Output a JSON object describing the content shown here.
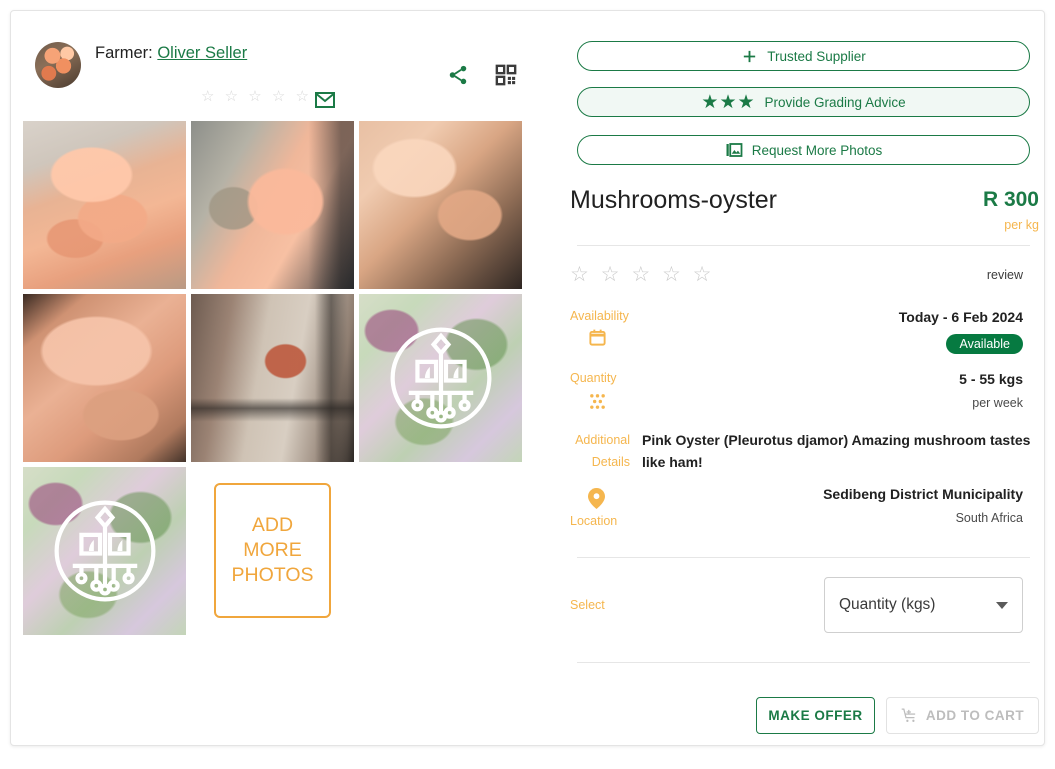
{
  "header": {
    "farmer_prefix": "Farmer:",
    "farmer_name": "Oliver Seller",
    "farmer_stars": "☆ ☆ ☆ ☆ ☆",
    "avatar_name": "farmer-avatar",
    "mail_icon": "mail-icon",
    "share_icon": "share-icon",
    "qr_icon": "qr-code-icon"
  },
  "gallery": {
    "add_more_label": "ADD\nMORE\nPHOTOS",
    "photos": [
      {
        "alt": "pink-oyster-mushroom-held-in-hand"
      },
      {
        "alt": "pink-oyster-mushroom-growing-on-substrate"
      },
      {
        "alt": "pink-oyster-mushroom-cluster-closeup"
      },
      {
        "alt": "pink-oyster-mushroom-caps-macro"
      },
      {
        "alt": "mushroom-fruiting-block-on-shelf"
      },
      {
        "alt": "placeholder-logo-vegetables"
      },
      {
        "alt": "placeholder-logo-vegetables"
      },
      {
        "alt": "placeholder-logo-vegetables"
      }
    ]
  },
  "actions": {
    "trusted_supplier": "Trusted Supplier",
    "trusted_supplier_icon": "plus-icon",
    "grading_advice": "Provide Grading Advice",
    "grading_advice_stars": "★★★",
    "request_photos": "Request More Photos",
    "request_photos_icon": "photo-library-icon"
  },
  "product": {
    "title": "Mushrooms-oyster",
    "price": "R 300",
    "price_unit": "per kg",
    "rating_stars": "☆ ☆ ☆ ☆ ☆",
    "review_label": "review"
  },
  "details": {
    "availability_label": "Availability",
    "availability_icon": "calendar-icon",
    "availability_value": "Today - 6 Feb 2024",
    "availability_badge": "Available",
    "quantity_label": "Quantity",
    "quantity_icon": "grain-dots-icon",
    "quantity_value": "5 - 55 kgs",
    "quantity_period": "per week",
    "additional_label": "Additional Details",
    "additional_text": "Pink Oyster (Pleurotus djamor) Amazing mushroom tastes like ham!",
    "location_label": "Location",
    "location_icon": "location-pin-icon",
    "location_value": "Sedibeng District Municipality",
    "location_country": "South Africa"
  },
  "select": {
    "label": "Select",
    "value": "Quantity (kgs)",
    "caret_icon": "chevron-down-icon"
  },
  "footer": {
    "make_offer": "MAKE OFFER",
    "add_to_cart": "ADD TO CART",
    "cart_icon": "add-shopping-cart-icon"
  },
  "colors": {
    "green": "#1b7a46",
    "badge_green": "#067a41",
    "orange": "#f5b64e",
    "add_photos_orange": "#f0a63c",
    "star_gray": "#c9c9c9"
  }
}
